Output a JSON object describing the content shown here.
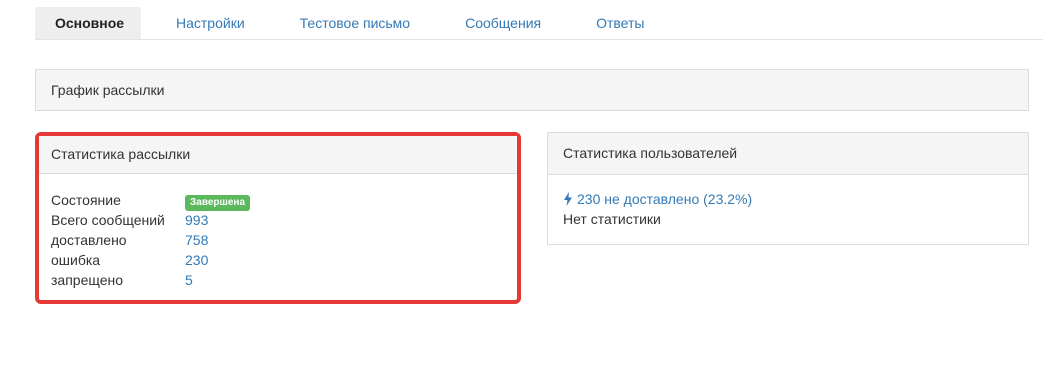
{
  "tabs": [
    {
      "label": "Основное",
      "active": true
    },
    {
      "label": "Настройки",
      "active": false
    },
    {
      "label": "Тестовое письмо",
      "active": false
    },
    {
      "label": "Сообщения",
      "active": false
    },
    {
      "label": "Ответы",
      "active": false
    }
  ],
  "schedule_panel": {
    "title": "График рассылки"
  },
  "stats_panel": {
    "title": "Статистика рассылки",
    "rows": [
      {
        "label": "Состояние",
        "value": "Завершена",
        "type": "badge"
      },
      {
        "label": "Всего сообщений",
        "value": "993"
      },
      {
        "label": "доставлено",
        "value": "758"
      },
      {
        "label": "ошибка",
        "value": "230"
      },
      {
        "label": "запрещено",
        "value": "5"
      }
    ]
  },
  "users_panel": {
    "title": "Статистика пользователей",
    "undelivered_link": "230 не доставлено (23.2%)",
    "no_stats": "Нет статистики",
    "icon": "bolt-icon"
  },
  "colors": {
    "link": "#337ab7",
    "badge_success": "#5cb85c",
    "highlight_border": "#e53935",
    "panel_heading_bg": "#f5f5f5"
  }
}
